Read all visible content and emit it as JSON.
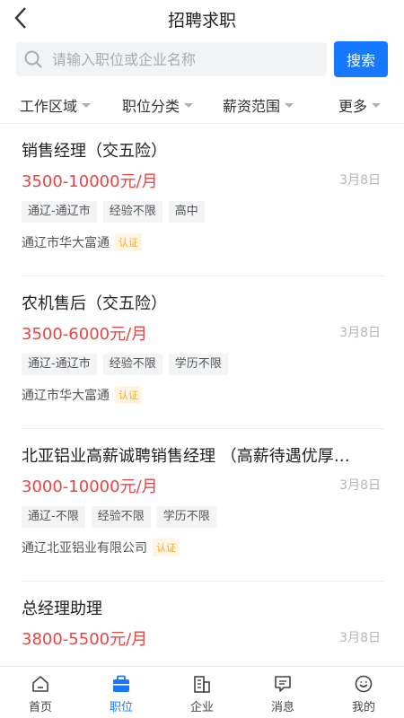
{
  "header": {
    "title": "招聘求职"
  },
  "search": {
    "placeholder": "请输入职位或企业名称",
    "button_label": "搜索"
  },
  "filters": [
    "工作区域",
    "职位分类",
    "薪资范围",
    "更多"
  ],
  "jobs": [
    {
      "title": "销售经理（交五险）",
      "salary": "3500-10000元/月",
      "date": "3月8日",
      "tags": [
        "通辽-通辽市",
        "经验不限",
        "高中"
      ],
      "company": "通辽市华大富通",
      "verified": "认证"
    },
    {
      "title": "农机售后（交五险）",
      "salary": "3500-6000元/月",
      "date": "3月8日",
      "tags": [
        "通辽-通辽市",
        "经验不限",
        "学历不限"
      ],
      "company": "通辽市华大富通",
      "verified": "认证"
    },
    {
      "title": "北亚铝业高薪诚聘销售经理 （高薪待遇优厚…",
      "salary": "3000-10000元/月",
      "date": "3月8日",
      "tags": [
        "通辽-不限",
        "经验不限",
        "学历不限"
      ],
      "company": "通辽北亚铝业有限公司",
      "verified": "认证"
    },
    {
      "title": "总经理助理",
      "salary": "3800-5500元/月",
      "date": "3月8日",
      "tags": [],
      "company": "",
      "verified": ""
    }
  ],
  "tabbar": {
    "active": "职位",
    "items": [
      {
        "label": "首页",
        "icon": "home-icon"
      },
      {
        "label": "职位",
        "icon": "briefcase-icon"
      },
      {
        "label": "企业",
        "icon": "building-icon"
      },
      {
        "label": "消息",
        "icon": "message-icon"
      },
      {
        "label": "我的",
        "icon": "profile-icon"
      }
    ]
  },
  "colors": {
    "accent": "#1677ff",
    "salary": "#e84545",
    "verified_bg": "#fff5e3",
    "verified_text": "#f0a93a"
  }
}
